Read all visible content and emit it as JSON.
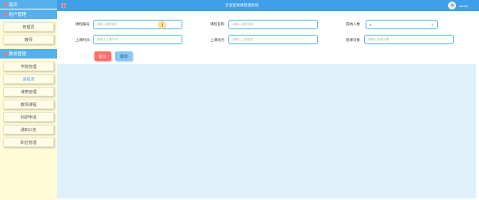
{
  "header": {
    "app_title": "实验室排课管理系统",
    "username": "admin"
  },
  "sidebar": {
    "home_label": "首页",
    "sections": [
      {
        "label": "用户管理",
        "items": [
          "管理员",
          "教师"
        ]
      },
      {
        "label": "教务管理",
        "items": [
          "学院管理",
          "课程表",
          "课表管理",
          "教师课程",
          "科研申请",
          "通知公告",
          "职位管理"
        ]
      }
    ],
    "active_item": "课程表"
  },
  "form": {
    "course_no_label": "课程编号",
    "course_no_placeholder": "请输入课程编号",
    "course_name_label": "课程名称",
    "course_name_placeholder": "请输入课程名称",
    "capacity_label": "容纳人数",
    "capacity_value": "0",
    "time_label": "上课时间",
    "time_placeholder": "请输入上课时间",
    "place_label": "上课地点",
    "place_placeholder": "请输入上课地点",
    "target_label": "授课对象",
    "target_placeholder": "请输入授课对象"
  },
  "buttons": {
    "submit": "提交",
    "cancel": "取消"
  },
  "colors": {
    "topbar": "#3f9fe8",
    "sidebar_bg": "#fffbd8",
    "sidebar_header": "#56b0ec",
    "content_bg": "#dff0fb",
    "submit_btn": "#ff7067",
    "cancel_btn": "#86c8f5"
  }
}
